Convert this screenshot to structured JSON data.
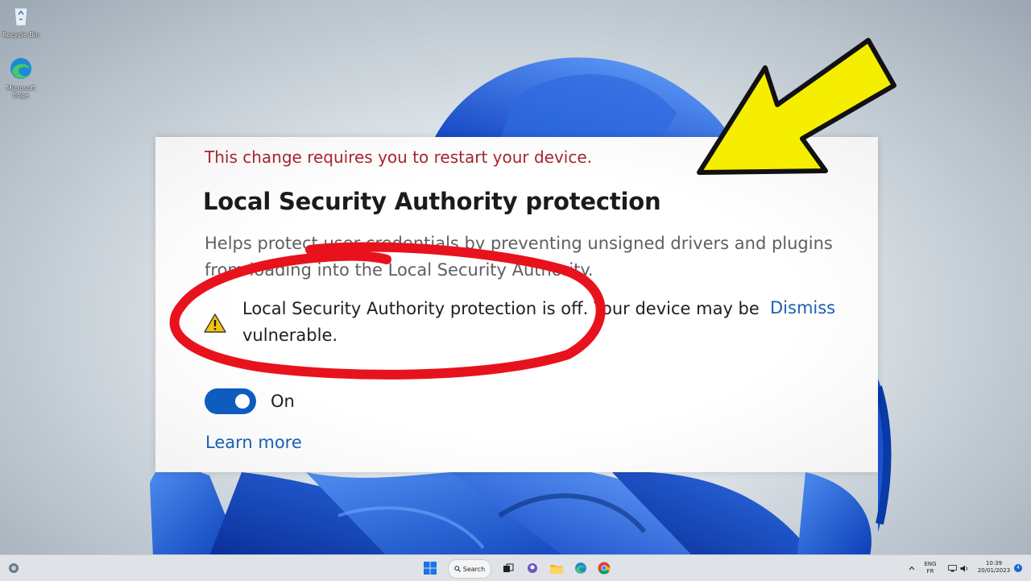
{
  "desktop": {
    "icons": [
      {
        "label": "Recycle Bin",
        "icon": "recycle-bin-icon"
      },
      {
        "label": "Microsoft Edge",
        "icon": "edge-icon"
      }
    ]
  },
  "settings_card": {
    "restart_notice": "This change requires you to restart your device.",
    "title": "Local Security Authority protection",
    "description": "Helps protect user credentials by preventing unsigned drivers and plugins from loading into the Local Security Authority.",
    "warning": {
      "icon": "warning-icon",
      "text": "Local Security Authority protection is off. Your device may be vulnerable.",
      "dismiss_label": "Dismiss"
    },
    "toggle": {
      "state": "on",
      "label": "On"
    },
    "learn_more_label": "Learn more"
  },
  "annotation": {
    "arrow_color": "#f5ee00",
    "circle_color": "#e8121c"
  },
  "taskbar": {
    "search_label": "Search",
    "apps": [
      "start-icon",
      "search-icon",
      "task-view-icon",
      "chat-icon",
      "file-explorer-icon",
      "edge-icon",
      "chrome-icon"
    ],
    "language_top": "ENG",
    "language_bottom": "FR",
    "time": "10:39",
    "date": "20/01/2023",
    "notification_count": "4"
  },
  "colors": {
    "accent": "#0f5cc0",
    "link": "#1a5fb4",
    "error": "#a4262c"
  }
}
